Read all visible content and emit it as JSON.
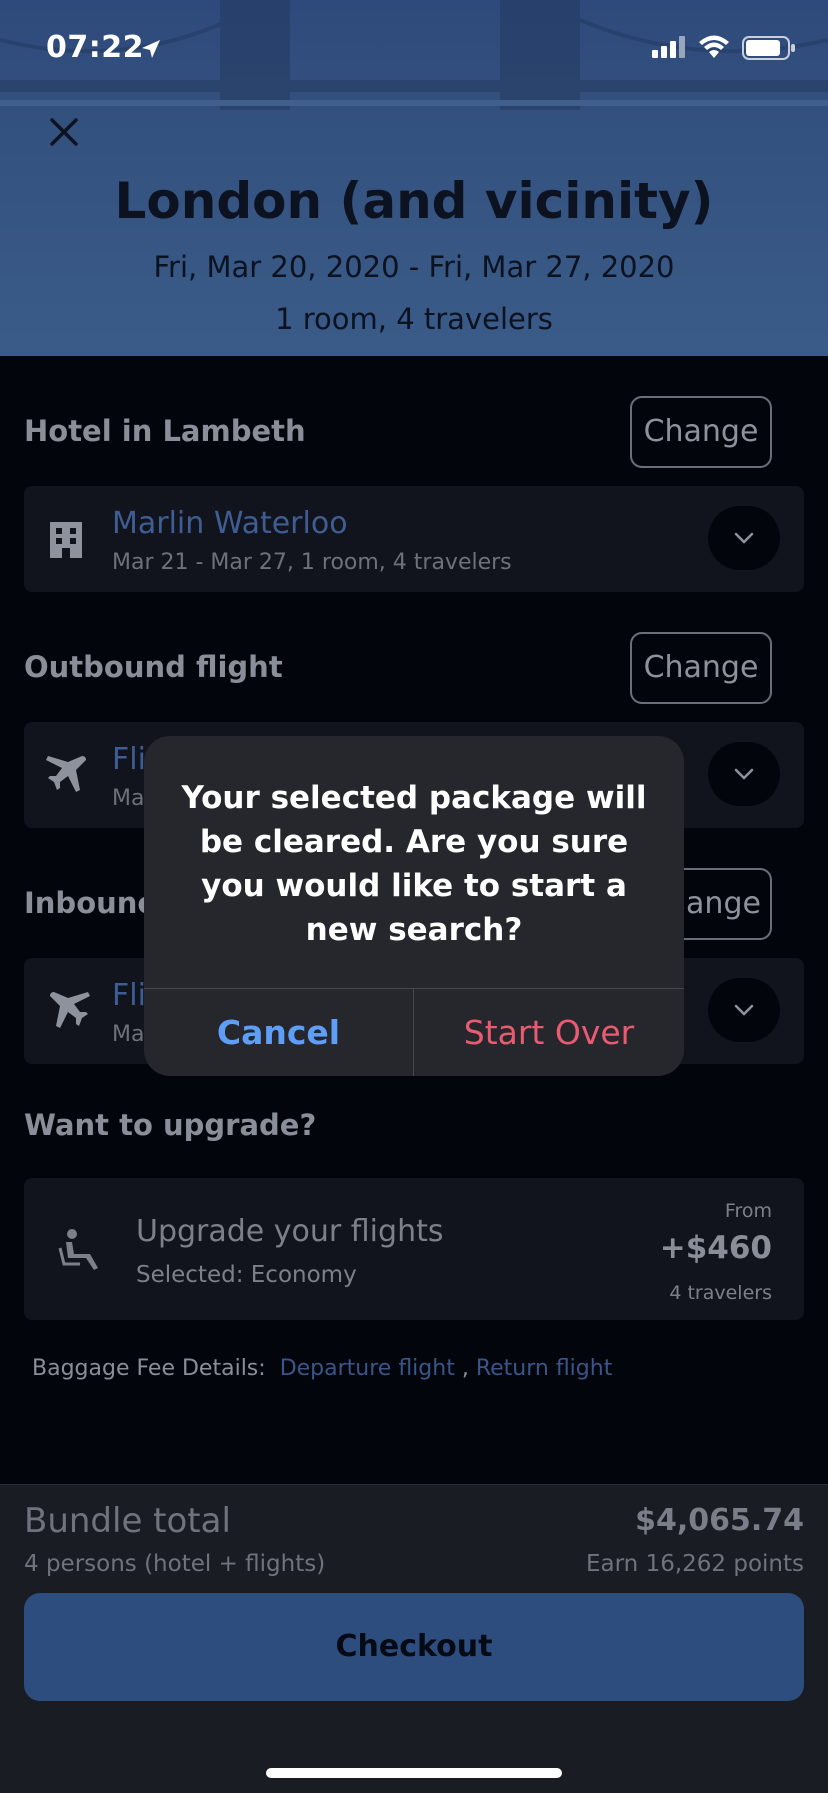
{
  "status_bar": {
    "time": "07:22"
  },
  "header": {
    "title": "London (and vicinity)",
    "dates": "Fri, Mar 20, 2020 - Fri, Mar 27, 2020",
    "rooms_travelers": "1 room, 4 travelers"
  },
  "hotel": {
    "section_title": "Hotel in Lambeth",
    "change_label": "Change",
    "name": "Marlin Waterloo",
    "details": "Mar 21 - Mar 27, 1 room, 4 travelers",
    "icon": "building-icon"
  },
  "outbound": {
    "section_title": "Outbound flight",
    "change_label": "Change",
    "name_partial": "Fli",
    "details_partial": "Ma",
    "icon": "airplane-icon"
  },
  "inbound": {
    "section_title_partial": "Inbounc",
    "change_label_partial": "hange",
    "name_partial": "Fli",
    "details_partial": "Ma",
    "icon": "airplane-icon"
  },
  "upgrade": {
    "section_title": "Want to upgrade?",
    "title": "Upgrade your flights",
    "selected": "Selected: Economy",
    "from_label": "From",
    "price": "+$460",
    "travelers": "4 travelers",
    "icon": "seat-icon"
  },
  "baggage": {
    "label": "Baggage Fee Details:",
    "departure_link": "Departure flight",
    "separator": ",",
    "return_link": "Return flight"
  },
  "footer": {
    "bundle_label": "Bundle total",
    "bundle_sub": "4 persons (hotel + flights)",
    "total": "$4,065.74",
    "points": "Earn 16,262 points",
    "checkout_label": "Checkout"
  },
  "alert": {
    "message": "Your selected package will be cleared. Are you sure you would like to start a new search?",
    "cancel_label": "Cancel",
    "start_over_label": "Start Over"
  },
  "colors": {
    "accent_blue": "#3f5d92",
    "alert_cancel": "#5e9ef7",
    "alert_destructive": "#ea5b72",
    "checkout_bg": "#2d4d7f"
  }
}
